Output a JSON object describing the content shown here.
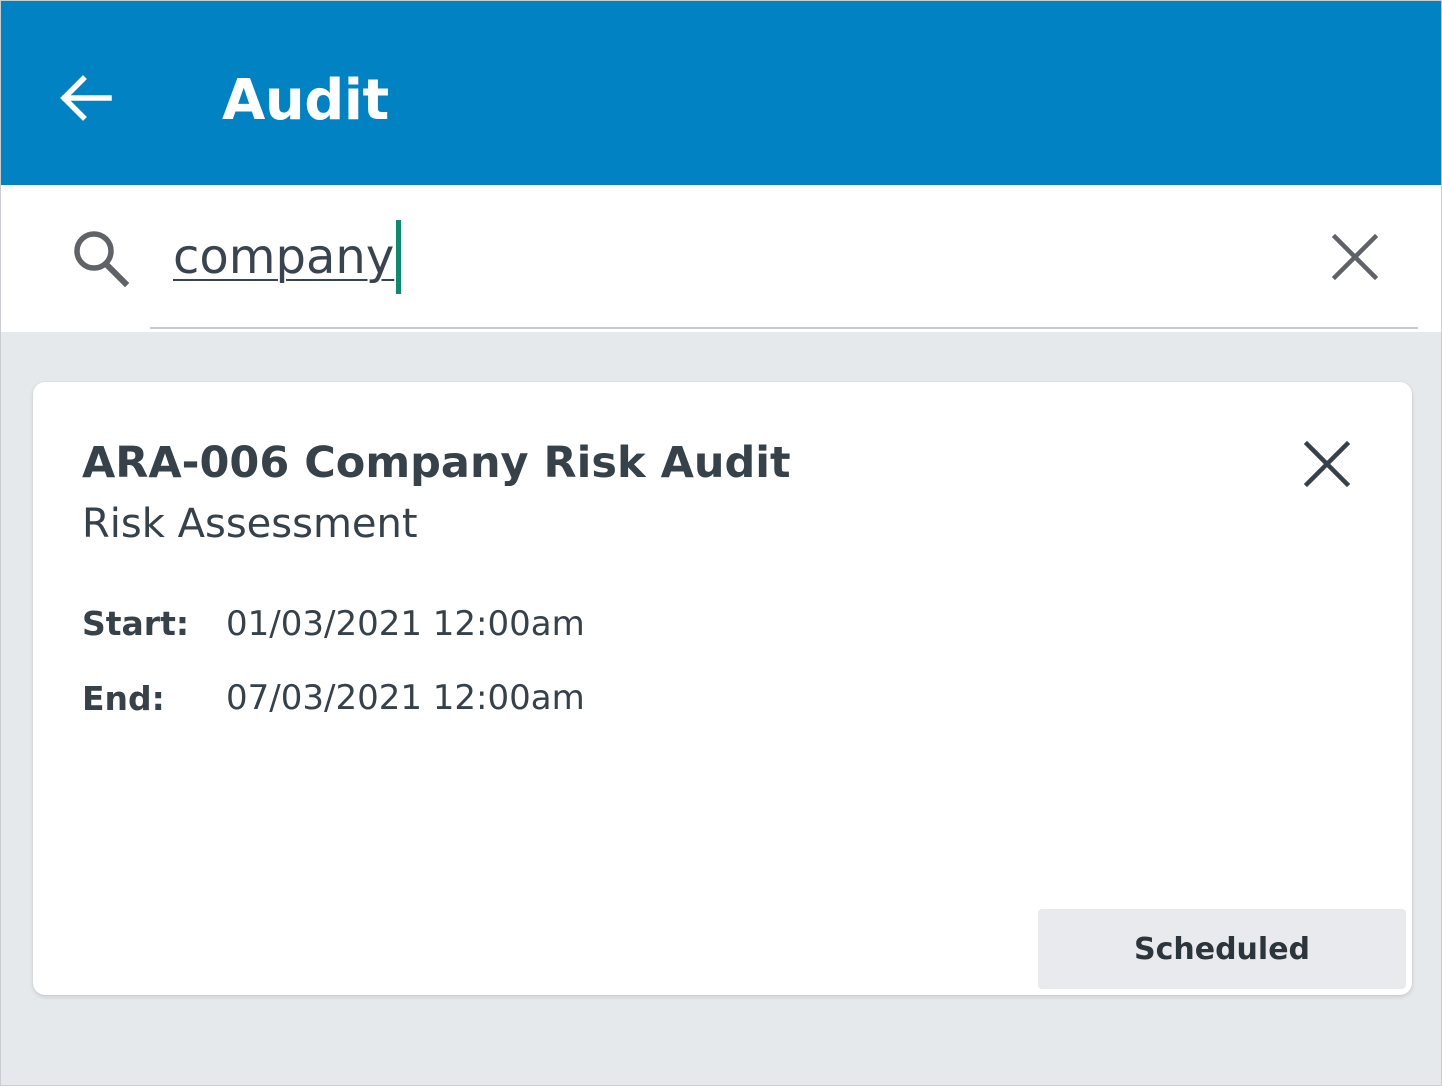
{
  "appbar": {
    "title": "Audit",
    "back_icon": "arrow-left-icon",
    "color": "#0082c3"
  },
  "search": {
    "value": "company",
    "search_icon": "search-icon",
    "clear_icon": "close-icon",
    "caret_color": "#0e8a6e"
  },
  "results": [
    {
      "title": "ARA-006 Company Risk Audit",
      "subtitle": "Risk Assessment",
      "dismiss_icon": "close-icon",
      "start_label": "Start:",
      "start_value": "01/03/2021 12:00am",
      "end_label": "End:",
      "end_value": "07/03/2021 12:00am",
      "status": "Scheduled"
    }
  ]
}
